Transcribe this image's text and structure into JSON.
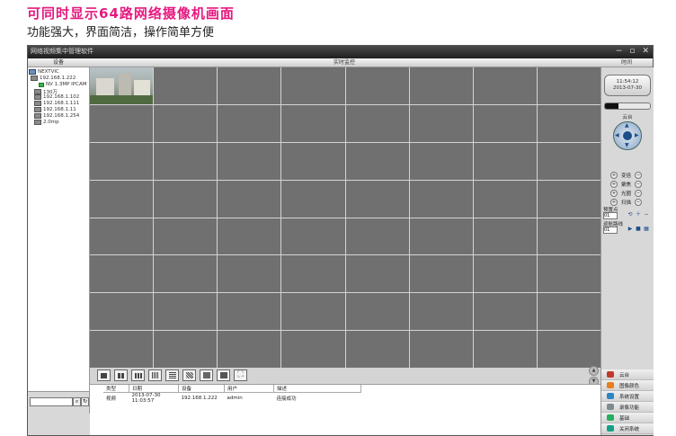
{
  "headline": "可同时显示64路网络摄像机画面",
  "subheadline": "功能强大，界面简洁，操作简单方便",
  "window": {
    "title": "网络视频集中管理软件",
    "controls": [
      "−",
      "▫",
      "✕"
    ]
  },
  "section_bar": {
    "devices": "设备",
    "realtime": "实时监控",
    "time": "时间"
  },
  "device_tree": [
    {
      "label": "NEXTVIC",
      "level": 0,
      "icon": "root"
    },
    {
      "label": "192.168.1.222",
      "level": 1,
      "icon": "dvr"
    },
    {
      "label": "NV 1.3MP IPCAM",
      "level": 2,
      "icon": "camera"
    },
    {
      "label": "130万",
      "level": 1,
      "icon": "dvr"
    },
    {
      "label": "192.168.1.102",
      "level": 1,
      "icon": "dvr"
    },
    {
      "label": "192.168.1.111",
      "level": 1,
      "icon": "dvr"
    },
    {
      "label": "192.168.1.11",
      "level": 1,
      "icon": "dvr"
    },
    {
      "label": "192.168.1.254",
      "level": 1,
      "icon": "dvr"
    },
    {
      "label": "2.0mp",
      "level": 1,
      "icon": "dvr"
    }
  ],
  "clock": {
    "time": "11:54:12",
    "date": "2013-07-30"
  },
  "ptz": {
    "title": "云台",
    "rows": [
      "变倍",
      "聚焦",
      "光圈",
      "扫描"
    ],
    "preset_label": "预置点",
    "preset_value": "01",
    "cruise_label": "巡航路线",
    "cruise_value": "01"
  },
  "log": {
    "headers": [
      "类型",
      "日期",
      "设备",
      "用户",
      "描述"
    ],
    "rows": [
      [
        "视频",
        "2013-07-30 11:03:57",
        "192.168.1.222",
        "admin",
        "连接成功"
      ]
    ]
  },
  "side_tabs": [
    {
      "label": "云台",
      "color": "#c0392b"
    },
    {
      "label": "图像颜色",
      "color": "#e67e22"
    },
    {
      "label": "系统设置",
      "color": "#2e86c1"
    },
    {
      "label": "录像功能",
      "color": "#7f8c8d"
    },
    {
      "label": "基础",
      "color": "#27ae60"
    },
    {
      "label": "关闭系统",
      "color": "#16a085"
    }
  ],
  "accent": "#e5197f"
}
